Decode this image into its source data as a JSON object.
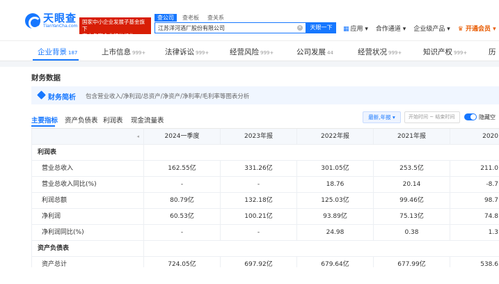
{
  "header": {
    "logo_cn": "天眼查",
    "logo_en": "TianYanCha.com",
    "gov_badge_line1": "国家中小企业发展子基金旗下",
    "gov_badge_line2": "官方备案企业征信机构",
    "search_tabs": [
      "查公司",
      "查老板",
      "查关系"
    ],
    "search_value": "江苏洋河酒厂股份有限公司",
    "search_button": "天眼一下",
    "nav": [
      {
        "label": "应用",
        "icon": "grid-icon"
      },
      {
        "label": "合作通道"
      },
      {
        "label": "企业级产品"
      },
      {
        "label": "开通会员"
      }
    ]
  },
  "tabs": [
    {
      "label": "企业背景",
      "count": "187"
    },
    {
      "label": "上市信息",
      "count": "999+"
    },
    {
      "label": "法律诉讼",
      "count": "999+"
    },
    {
      "label": "经营风险",
      "count": "999+"
    },
    {
      "label": "公司发展",
      "count": "44"
    },
    {
      "label": "经营状况",
      "count": "999+"
    },
    {
      "label": "知识产权",
      "count": "999+"
    },
    {
      "label": "历",
      "count": ""
    }
  ],
  "section": {
    "title": "财务数据",
    "info_title": "财务简析",
    "info_desc": "包含营业收入/净利润/总资产/净资产/净利率/毛利率等图表分析"
  },
  "subtabs": [
    "主要指标",
    "资产负债表",
    "利润表",
    "现金流量表"
  ],
  "controls": {
    "latest_button": "最新,年报 ▾",
    "date_range": "开始时间 ~ 结束时间",
    "toggle_label": "隐藏空",
    "toggle_on": true
  },
  "table": {
    "columns": [
      "2024一季度",
      "2023年报",
      "2022年报",
      "2021年报",
      "2020"
    ],
    "rows": [
      {
        "type": "group",
        "label": "利润表",
        "values": []
      },
      {
        "type": "data",
        "label": "营业总收入",
        "values": [
          "162.55亿",
          "331.26亿",
          "301.05亿",
          "253.5亿",
          "211.0"
        ]
      },
      {
        "type": "data",
        "label": "营业总收入同比(%)",
        "values": [
          "-",
          "-",
          "18.76",
          "20.14",
          "-8.7"
        ]
      },
      {
        "type": "data",
        "label": "利润总额",
        "values": [
          "80.79亿",
          "132.18亿",
          "125.03亿",
          "99.46亿",
          "98.7"
        ]
      },
      {
        "type": "data",
        "label": "净利润",
        "values": [
          "60.53亿",
          "100.21亿",
          "93.89亿",
          "75.13亿",
          "74.8"
        ]
      },
      {
        "type": "data",
        "label": "净利润同比(%)",
        "values": [
          "-",
          "-",
          "24.98",
          "0.38",
          "1.3"
        ]
      },
      {
        "type": "group",
        "label": "资产负债表",
        "values": []
      },
      {
        "type": "data",
        "label": "资产总计",
        "values": [
          "724.05亿",
          "697.92亿",
          "679.64亿",
          "677.99亿",
          "538.6"
        ]
      }
    ]
  },
  "colors": {
    "accent": "#1677ff",
    "badge_red": "#d81e06",
    "vip_orange": "#e85a00"
  }
}
